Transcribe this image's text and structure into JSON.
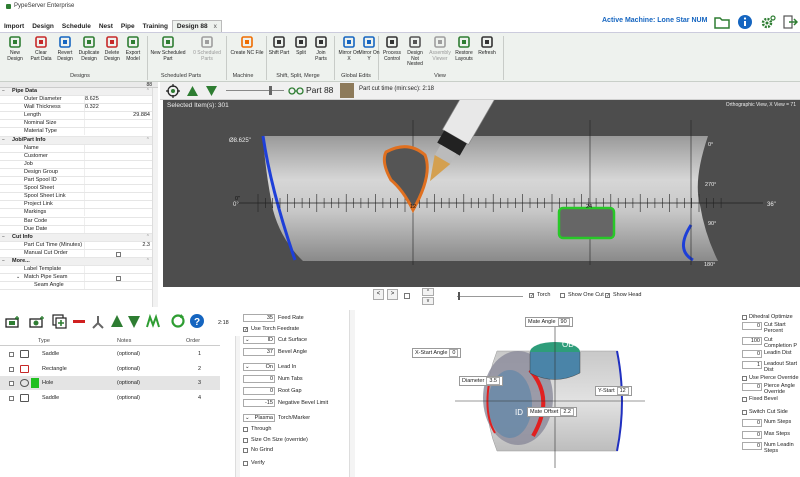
{
  "window": {
    "title": "PypeServer Enterprise"
  },
  "tabs": [
    {
      "label": "Import"
    },
    {
      "label": "Design"
    },
    {
      "label": "Schedule"
    },
    {
      "label": "Nest"
    },
    {
      "label": "Pipe"
    },
    {
      "label": "Training"
    },
    {
      "label": "Design 88",
      "active": true,
      "close": "x"
    }
  ],
  "active_machine": "Active Machine: Lone Star NUM",
  "ribbon": {
    "buttons": [
      {
        "id": "new-design",
        "label": "New Design"
      },
      {
        "id": "clear-part-data",
        "label": "Clear Part Data"
      },
      {
        "id": "revert-design",
        "label": "Revert Design"
      },
      {
        "id": "duplicate-design",
        "label": "Duplicate Design"
      },
      {
        "id": "delete-design",
        "label": "Delete Design"
      },
      {
        "id": "export-model",
        "label": "Export Model"
      },
      {
        "id": "new-scheduled-part",
        "label": "New Scheduled Part"
      },
      {
        "id": "scheduled-parts-count",
        "label": "0 Scheduled Parts"
      },
      {
        "id": "create-nc-file",
        "label": "Create NC File"
      },
      {
        "id": "shift-part",
        "label": "Shift Part"
      },
      {
        "id": "split",
        "label": "Split"
      },
      {
        "id": "join-parts",
        "label": "Join Parts"
      },
      {
        "id": "mirror-on-x",
        "label": "Mirror On X"
      },
      {
        "id": "mirror-on-y",
        "label": "Mirror On Y"
      },
      {
        "id": "process-control",
        "label": "Process Control"
      },
      {
        "id": "design-not-nested",
        "label": "Design Not Nested"
      },
      {
        "id": "assembly-viewer",
        "label": "Assembly Viewer"
      },
      {
        "id": "restore-layouts",
        "label": "Restore Layouts"
      },
      {
        "id": "refresh",
        "label": "Refresh"
      }
    ],
    "groups": [
      "Designs",
      "Scheduled Parts",
      "Machine",
      "Shift, Split, Merge",
      "Global Edits",
      "View"
    ]
  },
  "left_panel": {
    "header_value": "88",
    "rows": [
      {
        "type": "cat",
        "name": "Pipe Data"
      },
      {
        "name": "Outer Diameter",
        "value": "8.625",
        "align": "left"
      },
      {
        "name": "Wall Thickness",
        "value": "0.322",
        "align": "left"
      },
      {
        "name": "Length",
        "value": "29.884",
        "align": "right"
      },
      {
        "name": "Nominal Size",
        "value": ""
      },
      {
        "name": "Material Type",
        "value": ""
      },
      {
        "type": "cat",
        "name": "Job/Part Info"
      },
      {
        "name": "Name",
        "value": ""
      },
      {
        "name": "Customer",
        "value": ""
      },
      {
        "name": "Job",
        "value": ""
      },
      {
        "name": "Design Group",
        "value": ""
      },
      {
        "name": "Part Spool ID",
        "value": ""
      },
      {
        "name": "Spool Sheet",
        "value": ""
      },
      {
        "name": "Spool Sheet Link",
        "value": ""
      },
      {
        "name": "Project Link",
        "value": ""
      },
      {
        "name": "Markings",
        "value": ""
      },
      {
        "name": "Bar Code",
        "value": ""
      },
      {
        "name": "Due Date",
        "value": ""
      },
      {
        "type": "cat",
        "name": "Cut Info"
      },
      {
        "name": "Part Cut Time (Minutes)",
        "value": "2.3",
        "align": "right"
      },
      {
        "name": "Manual Cut Order",
        "value": "",
        "check": true
      },
      {
        "type": "cat",
        "name": "More..."
      },
      {
        "name": "Label Template",
        "value": ""
      },
      {
        "name": "Match Pipe Seam",
        "value": "",
        "check": true,
        "mk": "⌄"
      },
      {
        "name": "Seam Angle",
        "value": "",
        "indent": true
      }
    ]
  },
  "view_toolbar": {
    "part_label": "Part 88",
    "cut_time_label": "Part cut time (min:sec): 2:18"
  },
  "viewport": {
    "selected": "Selected Item(s): 301",
    "orth": "Orthographic View,  X View = 71",
    "diameter_label": "Ø8.625\"",
    "angle_labels": [
      "0°",
      "270°",
      "90°",
      "180°"
    ],
    "x_tick_labels": [
      "0\"",
      "12",
      "24",
      "36\""
    ],
    "zero_angle": "0°"
  },
  "viewport_controls": {
    "show_torch": "Torch",
    "show_one_cut": "Show One Cut",
    "show_head": "Show Head",
    "nav_left": "<",
    "nav_right": ">",
    "up": "^",
    "down": "v"
  },
  "cut_toolbar": {
    "time": "2:18"
  },
  "cut_table": {
    "columns": [
      "Type",
      "Notes",
      "Order"
    ],
    "rows": [
      {
        "type": "Saddle",
        "notes": "(optional)",
        "order": "1"
      },
      {
        "type": "Rectangle",
        "notes": "(optional)",
        "order": "2"
      },
      {
        "type": "Hole",
        "notes": "(optional)",
        "order": "3",
        "selected": true
      },
      {
        "type": "Saddle",
        "notes": "(optional)",
        "order": "4"
      }
    ]
  },
  "params": {
    "feed_rate": {
      "value": "35",
      "label": "Feed Rate"
    },
    "use_torch_feedrate": "Use Torch Feedrate",
    "cut_surface": {
      "value": "ID",
      "label": "Cut Surface"
    },
    "bevel_angle": {
      "value": "37",
      "label": "Bevel Angle"
    },
    "lead_in": {
      "value": "On",
      "label": "Lead In"
    },
    "num_tabs": {
      "value": "0",
      "label": "Num Tabs"
    },
    "root_gap": {
      "value": "0",
      "label": "Root Gap"
    },
    "negative_bevel_limit": {
      "value": "-15",
      "label": "Negative Bevel Limit"
    },
    "torch_marker": {
      "value": "Plasma",
      "label": "Torch/Marker"
    },
    "through": "Through",
    "size_on_size": "Size On Size (override)",
    "no_grind": "No Grind",
    "verify": "Verify"
  },
  "diagram": {
    "mate_angle": {
      "label": "Mate Angle",
      "value": "90"
    },
    "x_start_angle": {
      "label": "X-Start Angle",
      "value": "0"
    },
    "diameter": {
      "label": "Diameter",
      "value": "3.5"
    },
    "y_start": {
      "label": "Y-Start",
      "value": "12"
    },
    "mate_offset": {
      "label": "Mate Offset",
      "value": "2.2"
    },
    "od_label": "OD",
    "id_label": "ID"
  },
  "right_params": {
    "dihedral_optimize": "Dihedral Optimize",
    "cut_start_percent": {
      "value": "0",
      "label": "Cut Start Percent"
    },
    "cut_completion": {
      "value": "100",
      "label": "Cut Completion P"
    },
    "leadin_dist": {
      "value": "0",
      "label": "Leadin Dist"
    },
    "leadout_start_dist": {
      "value": "1",
      "label": "Leadout Start Dist"
    },
    "use_pierce_override": "Use Pierce Override",
    "pierce_angle_override": {
      "value": "0",
      "label": "Pierce Angle Override"
    },
    "fixed_bevel": "Fixed Bevel",
    "switch_cut_side": "Switch Cut Side",
    "num_steps": {
      "value": "0",
      "label": "Num Steps"
    },
    "max_steps": {
      "value": "0",
      "label": "Max Steps"
    },
    "num_leadin_steps": {
      "value": "0",
      "label": "Num Leadin Steps"
    }
  }
}
